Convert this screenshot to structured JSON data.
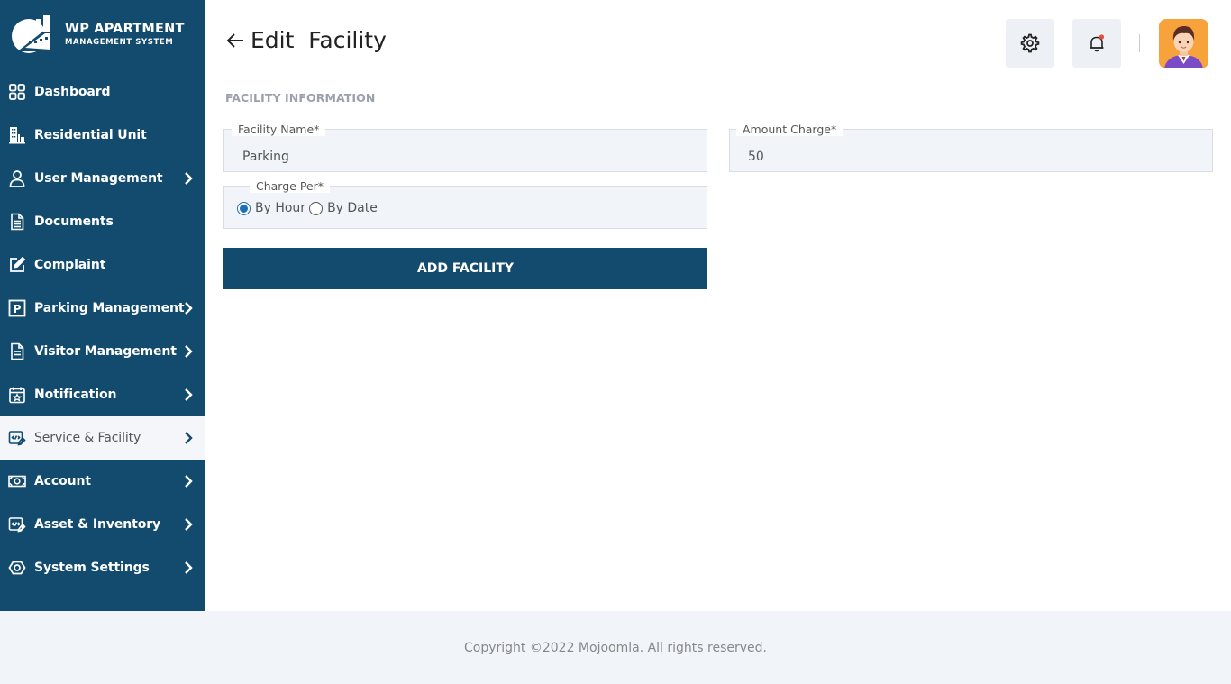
{
  "app": {
    "logo_title": "WP APARTMENT",
    "logo_subtitle": "MANAGEMENT SYSTEM"
  },
  "sidebar": {
    "items": [
      {
        "label": "Dashboard",
        "icon": "grid-icon",
        "has_submenu": false
      },
      {
        "label": "Residential Unit",
        "icon": "building-icon",
        "has_submenu": false
      },
      {
        "label": "User Management",
        "icon": "user-icon",
        "has_submenu": true
      },
      {
        "label": "Documents",
        "icon": "document-icon",
        "has_submenu": false
      },
      {
        "label": "Complaint",
        "icon": "edit-icon",
        "has_submenu": false
      },
      {
        "label": "Parking Management",
        "icon": "parking-icon",
        "has_submenu": true
      },
      {
        "label": "Visitor Management",
        "icon": "file-list-icon",
        "has_submenu": true
      },
      {
        "label": "Notification",
        "icon": "calendar-star-icon",
        "has_submenu": true
      },
      {
        "label": "Service & Facility",
        "icon": "service-icon",
        "has_submenu": true,
        "active": true
      },
      {
        "label": "Account",
        "icon": "money-icon",
        "has_submenu": true
      },
      {
        "label": "Asset & Inventory",
        "icon": "inventory-icon",
        "has_submenu": true
      },
      {
        "label": "System Settings",
        "icon": "eye-settings-icon",
        "has_submenu": true
      }
    ]
  },
  "header": {
    "title": "Edit  Facility"
  },
  "form": {
    "section_title": "FACILITY INFORMATION",
    "facility_name": {
      "label": "Facility Name*",
      "value": "Parking"
    },
    "amount_charge": {
      "label": "Amount Charge*",
      "value": "50"
    },
    "charge_per": {
      "label": "Charge Per*",
      "options": [
        "By Hour",
        "By Date"
      ],
      "selected": "By Hour"
    },
    "submit_label": "ADD FACILITY"
  },
  "footer": {
    "copyright": "Copyright ©2022 Mojoomla. All rights reserved."
  },
  "colors": {
    "sidebar_bg": "#134b6f",
    "accent": "#1c70b8",
    "notification_dot": "#e74c3c",
    "avatar_bg": "#f7a23b"
  }
}
